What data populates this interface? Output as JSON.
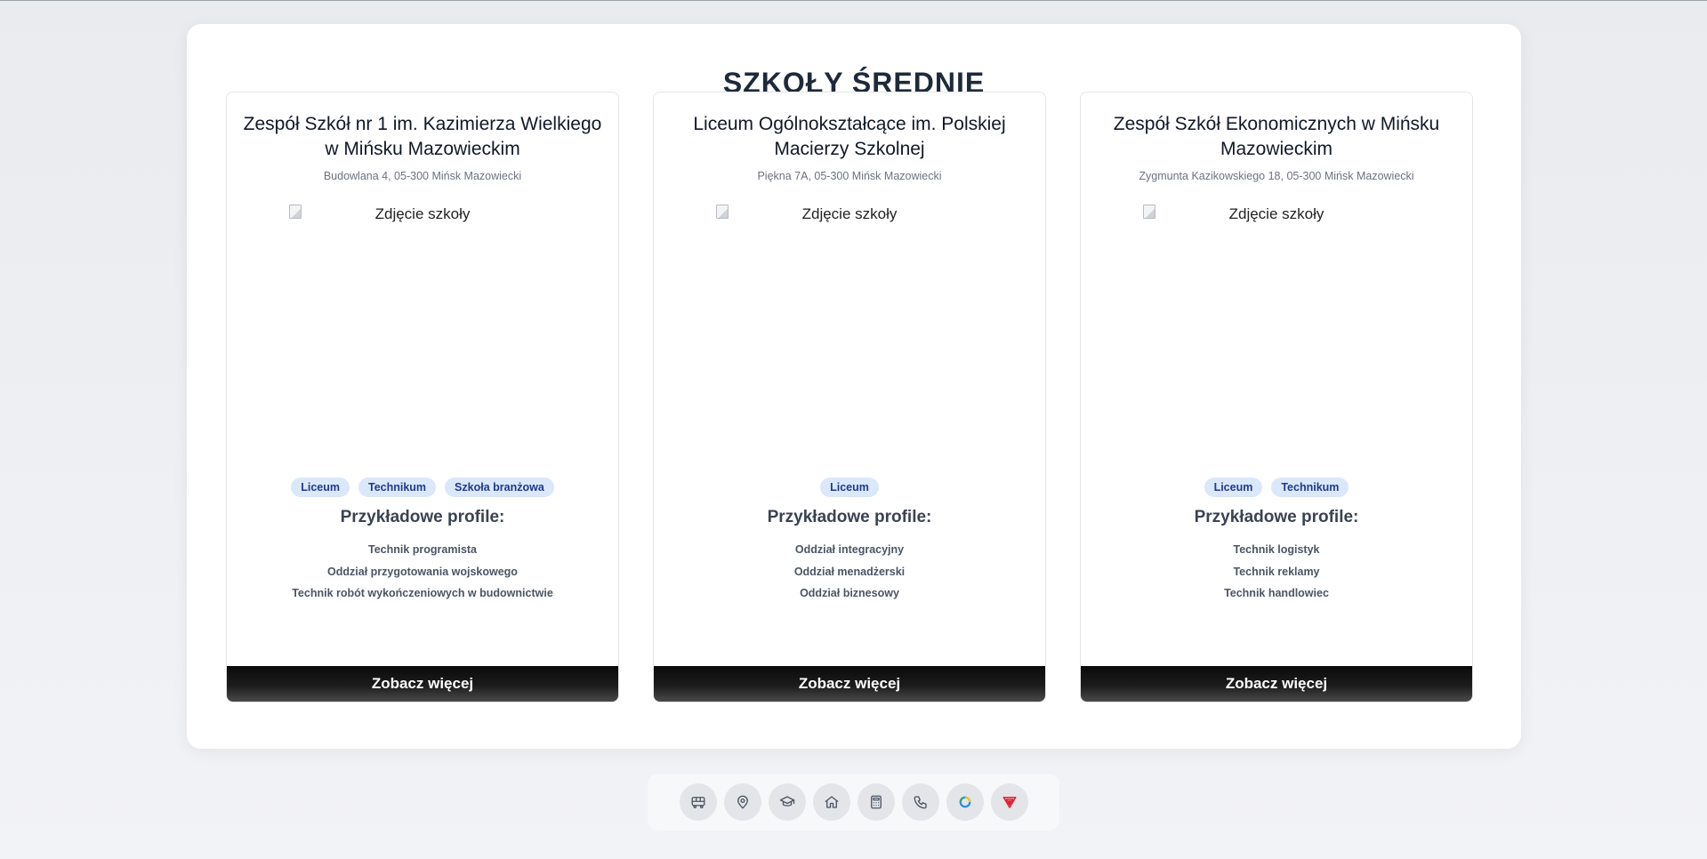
{
  "section": {
    "title": "SZKOŁY ŚREDNIE"
  },
  "schools": [
    {
      "name": "Zespół Szkół nr 1 im. Kazimierza Wielkiego w Mińsku Mazowieckim",
      "address": "Budowlana 4, 05-300 Mińsk Mazowiecki",
      "photo_alt": "Zdjęcie szkoły",
      "tags": [
        "Liceum",
        "Technikum",
        "Szkoła branżowa"
      ],
      "profiles_title": "Przykładowe profile:",
      "profiles": [
        "Technik programista",
        "Oddział przygotowania wojskowego",
        "Technik robót wykończeniowych w budownictwie"
      ],
      "button_label": "Zobacz więcej"
    },
    {
      "name": "Liceum Ogólnokształcące im. Polskiej Macierzy Szkolnej",
      "address": "Piękna 7A, 05-300 Mińsk Mazowiecki",
      "photo_alt": "Zdjęcie szkoły",
      "tags": [
        "Liceum"
      ],
      "profiles_title": "Przykładowe profile:",
      "profiles": [
        "Oddział integracyjny",
        "Oddział menadżerski",
        "Oddział biznesowy"
      ],
      "button_label": "Zobacz więcej"
    },
    {
      "name": "Zespół Szkół Ekonomicznych w Mińsku Mazowieckim",
      "address": "Zygmunta Kazikowskiego 18, 05-300 Mińsk Mazowiecki",
      "photo_alt": "Zdjęcie szkoły",
      "tags": [
        "Liceum",
        "Technikum"
      ],
      "profiles_title": "Przykładowe profile:",
      "profiles": [
        "Technik logistyk",
        "Technik reklamy",
        "Technik handlowiec"
      ],
      "button_label": "Zobacz więcej"
    }
  ],
  "dock": {
    "items": [
      "bus-icon",
      "map-pin-icon",
      "graduation-cap-icon",
      "home-icon",
      "calculator-icon",
      "phone-icon",
      "ring-logo-icon",
      "shield-logo-icon"
    ]
  },
  "colors": {
    "tag_bg": "#dbe7fb",
    "tag_text": "#1e3a8a",
    "button_bg": "#111111",
    "page_bg": "#eceef1"
  }
}
